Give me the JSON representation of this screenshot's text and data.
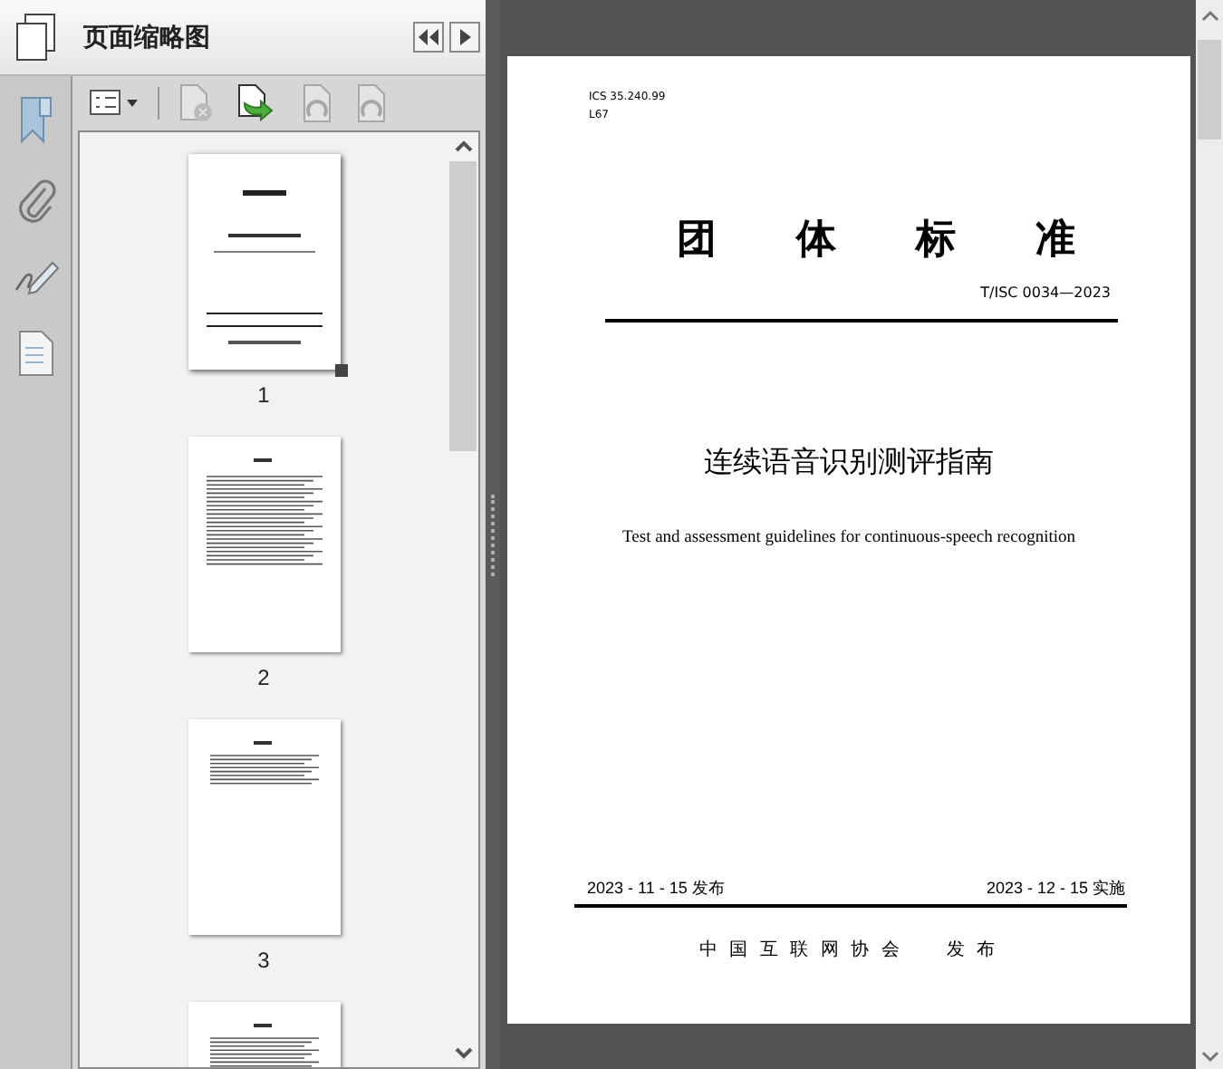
{
  "panel": {
    "title": "页面缩略图"
  },
  "toolbar": [
    {
      "kind": "options",
      "disabled": false
    },
    {
      "kind": "delete",
      "disabled": true
    },
    {
      "kind": "insert",
      "disabled": false
    },
    {
      "kind": "rotate-left",
      "disabled": true
    },
    {
      "kind": "rotate-right",
      "disabled": true
    }
  ],
  "thumbnails": [
    {
      "label": "1",
      "kind": "cover",
      "selected": true
    },
    {
      "label": "2",
      "kind": "contents",
      "selected": false
    },
    {
      "label": "3",
      "kind": "text",
      "selected": false
    },
    {
      "kind": "text",
      "selected": false
    }
  ],
  "document": {
    "ics": "ICS 35.240.99",
    "class_code": "L67",
    "heading": "团 体 标 准",
    "standard_number": "T/ISC 0034—2023",
    "title_zh": "连续语音识别测评指南",
    "title_en": "Test and assessment guidelines for continuous-speech recognition",
    "publish_date": "2023 - 11 - 15 发布",
    "effective_date": "2023 - 12 - 15 实施",
    "publisher": "中 国 互 联 网 协 会",
    "publisher_action": "发 布"
  }
}
